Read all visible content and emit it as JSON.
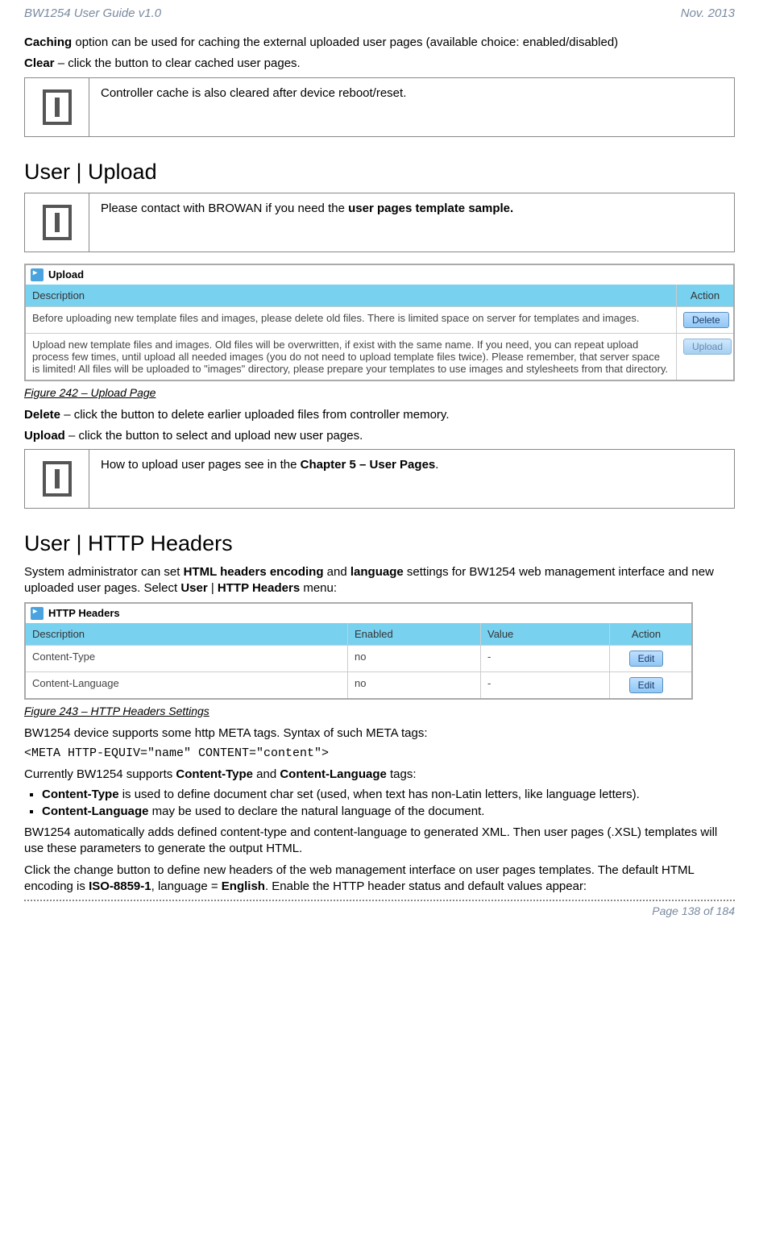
{
  "header": {
    "left": "BW1254 User Guide v1.0",
    "right": "Nov.  2013"
  },
  "p1": {
    "caching_strong": "Caching",
    "caching_rest": " option can be used for caching the external uploaded user pages (available choice: enabled/disabled)"
  },
  "p2": {
    "clear_strong": "Clear",
    "clear_rest": " – click the button to clear cached user pages."
  },
  "info1": "Controller cache is also cleared after device reboot/reset.",
  "h_upload": "User | Upload",
  "info2_pre": "Please contact with BROWAN if you need the ",
  "info2_strong": "user pages template sample.",
  "upload_shot": {
    "title": "Upload",
    "hdr_desc": "Description",
    "hdr_action": "Action",
    "rows": [
      {
        "desc": "Before uploading new template files and images, please delete old files. There is limited space on server for templates and images.",
        "btn": "Delete",
        "enabled": true
      },
      {
        "desc": "Upload new template files and images. Old files will be overwritten, if exist with the same name. If you need, you can repeat upload process few times, until upload all needed images (you do not need to upload template files twice). Please remember, that server space is limited! All files will be uploaded to \"images\" directory, please prepare your templates to use images and stylesheets from that directory.",
        "btn": "Upload",
        "enabled": false
      }
    ]
  },
  "fig242": "Figure 242 – Upload Page",
  "p_delete_strong": "Delete",
  "p_delete_rest": " – click the button to delete earlier uploaded files from controller memory.",
  "p_upload_strong": "Upload",
  "p_upload_rest": " – click the button to select and upload new user pages.",
  "info3_pre": "How to upload user pages see in the ",
  "info3_strong": "Chapter 5 – User Pages",
  "info3_post": ".",
  "h_http": "User | HTTP Headers",
  "p_http_intro_1": "System administrator can set ",
  "p_http_intro_s1": "HTML headers encoding",
  "p_http_intro_2": " and ",
  "p_http_intro_s2": "language",
  "p_http_intro_3": " settings for BW1254 web management interface and new uploaded user pages. Select ",
  "p_http_intro_s3": "User",
  "p_http_intro_4": " | ",
  "p_http_intro_s4": "HTTP Headers",
  "p_http_intro_5": " menu:",
  "http_shot": {
    "title": "HTTP Headers",
    "hdr_desc": "Description",
    "hdr_enabled": "Enabled",
    "hdr_value": "Value",
    "hdr_action": "Action",
    "rows": [
      {
        "desc": "Content-Type",
        "enabled": "no",
        "value": "-",
        "btn": "Edit"
      },
      {
        "desc": "Content-Language",
        "enabled": "no",
        "value": "-",
        "btn": "Edit"
      }
    ]
  },
  "fig243": "Figure 243 – HTTP Headers Settings",
  "p_meta": "BW1254 device supports some http META tags. Syntax of such META tags:",
  "code_meta": "<META HTTP-EQUIV=\"name\" CONTENT=\"content\">",
  "p_supports_pre": "Currently BW1254 supports ",
  "p_supports_s1": "Content-Type",
  "p_supports_mid": " and ",
  "p_supports_s2": "Content-Language",
  "p_supports_post": " tags:",
  "bullets": [
    {
      "strong": "Content-Type",
      "rest": " is used to define document char set (used, when text has non-Latin letters, like language letters)."
    },
    {
      "strong": "Content-Language",
      "rest": " may be used to declare the natural language of the document."
    }
  ],
  "p_auto": "BW1254 automatically adds defined content-type and content-language to generated XML. Then user pages (.XSL) templates will use these parameters to generate the output HTML.",
  "p_last_1": "Click the change button to define new headers of the web management interface on user pages templates. The default HTML encoding is ",
  "p_last_s1": "ISO-8859-1",
  "p_last_2": ", language = ",
  "p_last_s2": "English",
  "p_last_3": ". Enable the HTTP header status and default values appear:",
  "footer": "Page 138 of 184"
}
